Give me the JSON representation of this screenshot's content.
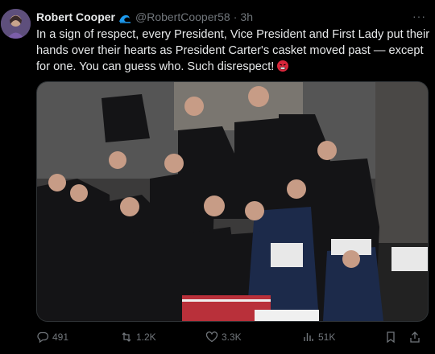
{
  "tweet": {
    "author_name": "Robert Cooper",
    "handle": "@RobertCooper58",
    "separator": "·",
    "time": "3h",
    "more": "···",
    "text": "In a sign of respect, every President, Vice President and First Lady put their hands over their hearts as President Carter's casket moved past — except for one. You can guess who. Such disrespect!",
    "emoji": "angry-face-emoji",
    "badge_icon": "wave-icon"
  },
  "actions": {
    "replies": "491",
    "reposts": "1.2K",
    "likes": "3.3K",
    "views": "51K"
  },
  "colors": {
    "background": "#000000",
    "text": "#e7e9ea",
    "muted": "#71767b",
    "wave_badge": "#1d9bf0",
    "emoji": "#d8253a"
  }
}
